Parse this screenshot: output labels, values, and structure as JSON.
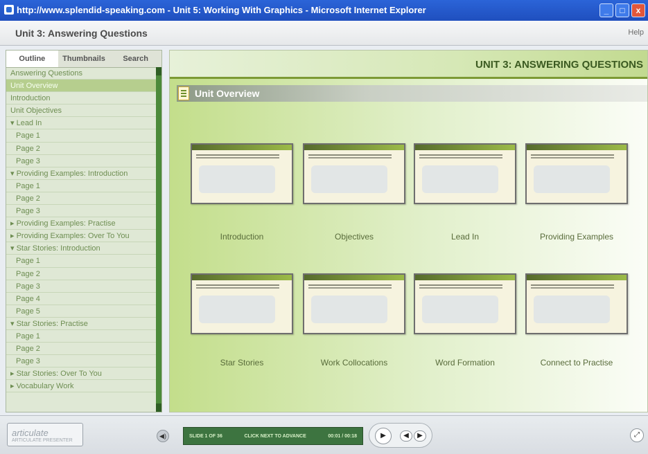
{
  "window": {
    "title": "http://www.splendid-speaking.com - Unit 5: Working With Graphics - Microsoft Internet Explorer",
    "buttons": [
      "_",
      "□",
      "x"
    ]
  },
  "header": {
    "title": "Unit 3: Answering Questions",
    "help": "Help"
  },
  "sidebar": {
    "tabs": [
      "Outline",
      "Thumbnails",
      "Search"
    ],
    "items": [
      {
        "label": "Answering Questions",
        "level": 0,
        "selected": false
      },
      {
        "label": "Unit Overview",
        "level": 0,
        "selected": true
      },
      {
        "label": "Introduction",
        "level": 0,
        "selected": false
      },
      {
        "label": "Unit Objectives",
        "level": 0,
        "selected": false
      },
      {
        "label": "▾ Lead In",
        "level": 0,
        "selected": false
      },
      {
        "label": "Page 1",
        "level": 1,
        "selected": false
      },
      {
        "label": "Page 2",
        "level": 1,
        "selected": false
      },
      {
        "label": "Page 3",
        "level": 1,
        "selected": false
      },
      {
        "label": "▾ Providing Examples: Introduction",
        "level": 0,
        "selected": false
      },
      {
        "label": "Page 1",
        "level": 1,
        "selected": false
      },
      {
        "label": "Page 2",
        "level": 1,
        "selected": false
      },
      {
        "label": "Page 3",
        "level": 1,
        "selected": false
      },
      {
        "label": "▸ Providing Examples: Practise",
        "level": 0,
        "selected": false
      },
      {
        "label": "▸ Providing Examples: Over To You",
        "level": 0,
        "selected": false
      },
      {
        "label": "▾ Star Stories: Introduction",
        "level": 0,
        "selected": false
      },
      {
        "label": "Page 1",
        "level": 1,
        "selected": false
      },
      {
        "label": "Page 2",
        "level": 1,
        "selected": false
      },
      {
        "label": "Page 3",
        "level": 1,
        "selected": false
      },
      {
        "label": "Page 4",
        "level": 1,
        "selected": false
      },
      {
        "label": "Page 5",
        "level": 1,
        "selected": false
      },
      {
        "label": "▾ Star Stories: Practise",
        "level": 0,
        "selected": false
      },
      {
        "label": "Page 1",
        "level": 1,
        "selected": false
      },
      {
        "label": "Page 2",
        "level": 1,
        "selected": false
      },
      {
        "label": "Page 3",
        "level": 1,
        "selected": false
      },
      {
        "label": "▸ Star Stories: Over To You",
        "level": 0,
        "selected": false
      },
      {
        "label": "▸ Vocabulary Work",
        "level": 0,
        "selected": false
      }
    ]
  },
  "content": {
    "unit_label": "UNIT 3: ANSWERING QUESTIONS",
    "section_title": "Unit Overview",
    "thumbnails": [
      "Introduction",
      "Objectives",
      "Lead In",
      "Providing Examples",
      "Star Stories",
      "Work Collocations",
      "Word Formation",
      "Connect to Practise"
    ]
  },
  "player": {
    "logo": "articulate",
    "logo_sub": "ARTICULATE PRESENTER",
    "status": [
      "SLIDE 1 OF 36",
      "CLICK NEXT TO ADVANCE",
      "00:01 / 00:18"
    ],
    "play": "▶",
    "prev": "◀",
    "next": "▶",
    "volume": "◀)",
    "fullscreen": "⤢"
  }
}
